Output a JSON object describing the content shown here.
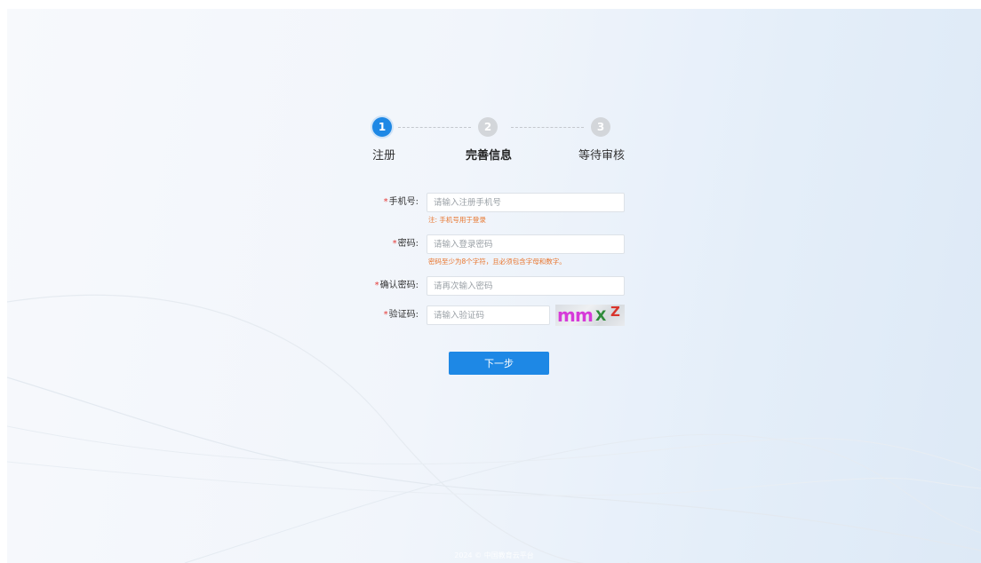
{
  "steps": [
    {
      "number": "1",
      "label": "注册",
      "state": "active"
    },
    {
      "number": "2",
      "label": "完善信息",
      "state": "inactive"
    },
    {
      "number": "3",
      "label": "等待审核",
      "state": "inactive"
    }
  ],
  "form": {
    "required_mark": "*",
    "phone": {
      "label": "手机号:",
      "placeholder": "请输入注册手机号",
      "hint": "注: 手机号用于登录"
    },
    "password": {
      "label": "密码:",
      "placeholder": "请输入登录密码",
      "hint": "密码至少为8个字符，且必须包含字母和数字。"
    },
    "confirm_password": {
      "label": "确认密码:",
      "placeholder": "请再次输入密码"
    },
    "captcha": {
      "label": "验证码:",
      "placeholder": "请输入验证码",
      "chars": [
        "m",
        "m",
        "X",
        "Z"
      ],
      "colors": [
        "#d63ad9",
        "#d63ad9",
        "#2e8b3a",
        "#d8342c"
      ]
    },
    "next_button": "下一步"
  },
  "footer": "2024 © 中国教育云平台",
  "colors": {
    "primary": "#1e88e5",
    "hint": "#e8732a",
    "required": "#e53935"
  }
}
